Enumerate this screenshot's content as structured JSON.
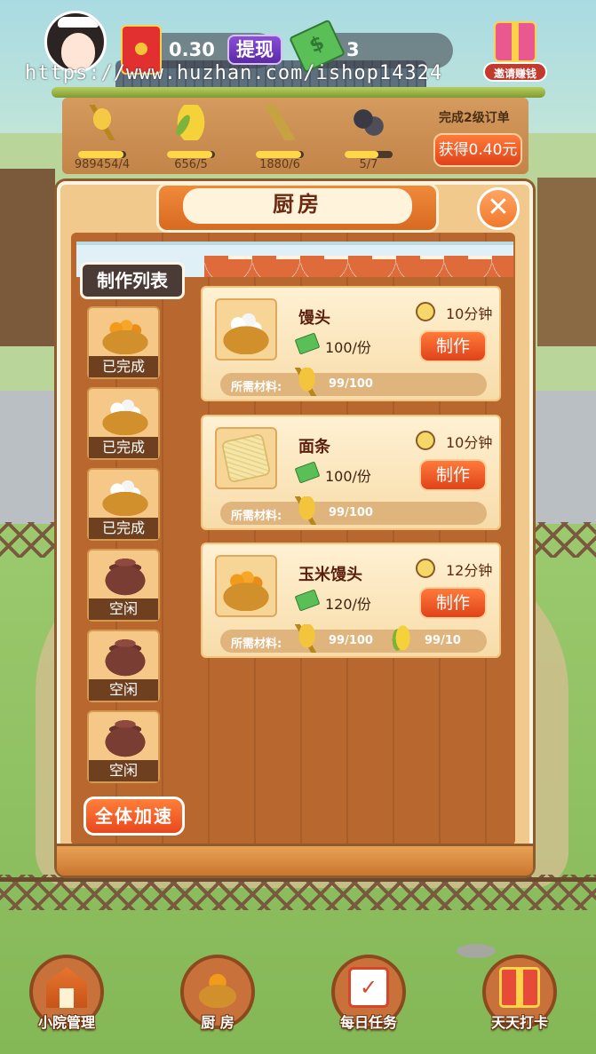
{
  "top_bar": {
    "red_packet_amount": "0.30",
    "withdraw_label": "提现",
    "cash_amount": "3",
    "invite_label": "邀请赚钱",
    "watermark": "https://www.huzhan.com/ishop14324"
  },
  "resources": [
    {
      "icon": "wheat-icon",
      "count": "989454/4",
      "progress": 0.95
    },
    {
      "icon": "corn-icon",
      "count": "656/5",
      "progress": 0.95
    },
    {
      "icon": "wheat-bundle-icon",
      "count": "1880/6",
      "progress": 0.95
    },
    {
      "icon": "bean-icon",
      "count": "5/7",
      "progress": 0.7
    }
  ],
  "order": {
    "label": "完成2级订单",
    "reward_button": "获得0.40元"
  },
  "kitchen": {
    "title": "厨房",
    "close_icon": "close-icon",
    "list_title": "制作列表",
    "slots": [
      {
        "icon": "corn-bun-steamer-icon",
        "status": "已完成"
      },
      {
        "icon": "white-bun-steamer-icon",
        "status": "已完成"
      },
      {
        "icon": "white-bun-steamer-icon",
        "status": "已完成"
      },
      {
        "icon": "clay-pot-icon",
        "status": "空闲"
      },
      {
        "icon": "clay-pot-icon",
        "status": "空闲"
      },
      {
        "icon": "clay-pot-icon",
        "status": "空闲"
      }
    ],
    "speed_button": "全体加速",
    "recipes": [
      {
        "name": "馒头",
        "time": "10分钟",
        "price": "100/份",
        "make_label": "制作",
        "materials_label": "所需材料:",
        "materials": [
          {
            "icon": "wheat-icon",
            "count": "99/100"
          }
        ]
      },
      {
        "name": "面条",
        "time": "10分钟",
        "price": "100/份",
        "make_label": "制作",
        "materials_label": "所需材料:",
        "materials": [
          {
            "icon": "wheat-icon",
            "count": "99/100"
          }
        ]
      },
      {
        "name": "玉米馒头",
        "time": "12分钟",
        "price": "120/份",
        "make_label": "制作",
        "materials_label": "所需材料:",
        "materials": [
          {
            "icon": "wheat-icon",
            "count": "99/100"
          },
          {
            "icon": "corn-icon",
            "count": "99/10"
          }
        ]
      }
    ]
  },
  "bottom_nav": [
    {
      "icon": "barn-icon",
      "label": "小院管理"
    },
    {
      "icon": "steamer-icon",
      "label": "厨 房"
    },
    {
      "icon": "calendar-icon",
      "label": "每日任务"
    },
    {
      "icon": "gift-icon",
      "label": "天天打卡"
    }
  ],
  "colors": {
    "accent_orange": "#e8481c",
    "wood_brown": "#b8672e",
    "status_bar_brown": "#6e4020"
  }
}
